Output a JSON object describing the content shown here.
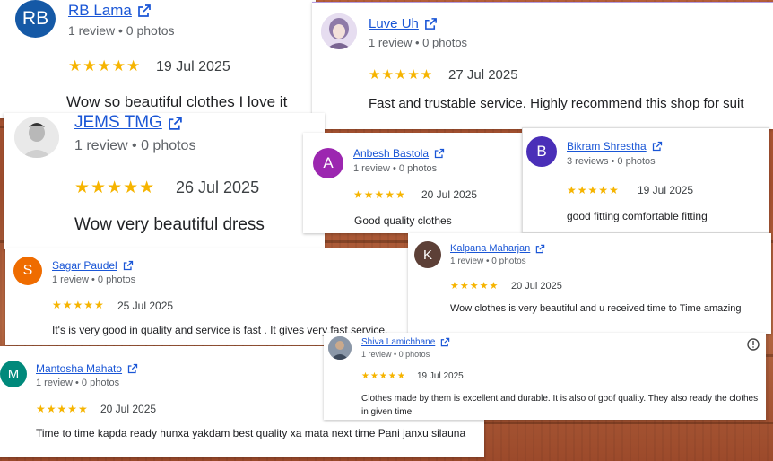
{
  "reviews": {
    "rb": {
      "initials": "RB",
      "name": "RB Lama",
      "meta": "1 review • 0 photos",
      "stars": "★★★★★",
      "date": "19 Jul 2025",
      "text": "Wow so beautiful clothes I love it"
    },
    "luve": {
      "name": "Luve Uh",
      "meta": "1 review • 0 photos",
      "stars": "★★★★★",
      "date": "27 Jul 2025",
      "text": "Fast and trustable service. Highly recommend this shop for suit"
    },
    "jems": {
      "name": "JEMS TMG",
      "meta": "1 review • 0 photos",
      "stars": "★★★★★",
      "date": "26 Jul 2025",
      "text": "Wow very beautiful dress"
    },
    "anbesh": {
      "initials": "A",
      "name": "Anbesh Bastola",
      "meta": "1 review • 0 photos",
      "stars": "★★★★★",
      "date": "20 Jul 2025",
      "text": "Good quality clothes"
    },
    "bikram": {
      "initials": "B",
      "name": "Bikram Shrestha",
      "meta": "3 reviews • 0 photos",
      "stars": "★★★★★",
      "date": "19 Jul 2025",
      "text": "good fitting comfortable fitting"
    },
    "sagar": {
      "initials": "S",
      "name": "Sagar Paudel",
      "meta": "1 review • 0 photos",
      "stars": "★★★★★",
      "date": "25 Jul 2025",
      "text": "It's is very good in quality and service is fast . It gives very fast service."
    },
    "kalpana": {
      "initials": "K",
      "name": "Kalpana Maharjan",
      "meta": "1 review • 0 photos",
      "stars": "★★★★★",
      "date": "20 Jul 2025",
      "text": "Wow clothes is very beautiful and u received time to Time amazing"
    },
    "shiva": {
      "name": "Shiva Lamichhane",
      "meta": "1 review • 0 photos",
      "stars": "★★★★★",
      "date": "19 Jul 2025",
      "text": "Clothes made by them is excellent and durable. It is also of goof quality. They also ready the clothes in given time."
    },
    "mantosha": {
      "initials": "M",
      "name": "Mantosha Mahato",
      "meta": "1 review • 0 photos",
      "stars": "★★★★★",
      "date": "20 Jul 2025",
      "text": "Time to time kapda ready hunxa yakdam best quality xa mata next time Pani janxu silauna"
    }
  },
  "colors": {
    "link": "#1a56d6",
    "star": "#f6b400",
    "avatar_rb": "#1559a6",
    "avatar_a": "#9c27b0",
    "avatar_b": "#4a2fb8",
    "avatar_s": "#ef6c00",
    "avatar_k": "#5d4037",
    "avatar_m": "#00897b"
  },
  "icons": {
    "external": "external-link-icon",
    "info": "info-icon"
  }
}
